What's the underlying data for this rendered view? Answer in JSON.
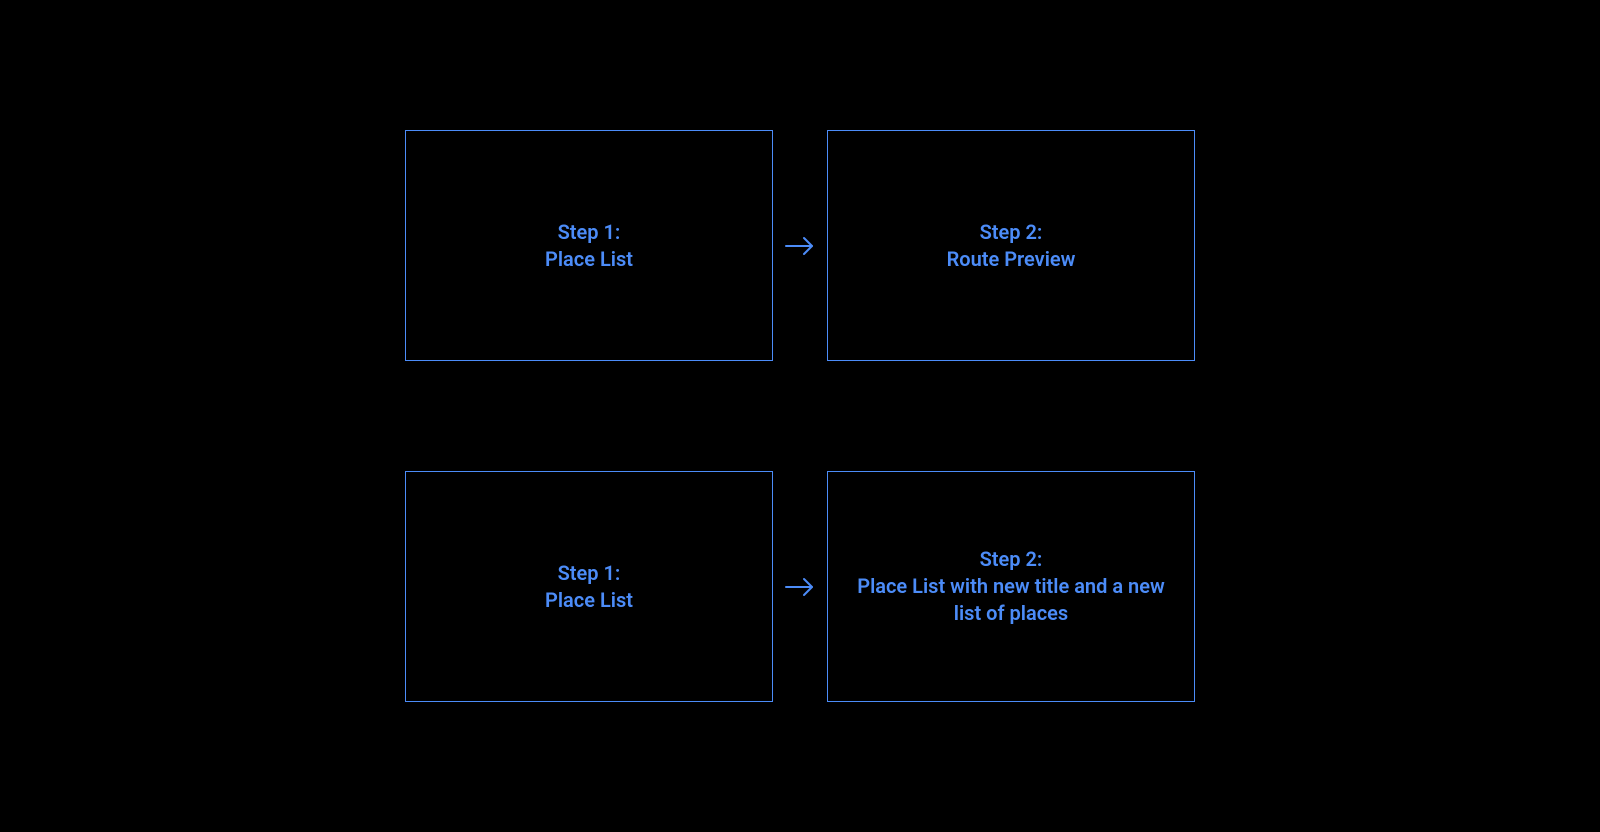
{
  "flows": [
    {
      "step1": "Step 1:\nPlace List",
      "step2": "Step 2:\nRoute Preview"
    },
    {
      "step1": "Step 1:\nPlace List",
      "step2": "Step 2:\nPlace List with new title and a new list of places"
    }
  ]
}
